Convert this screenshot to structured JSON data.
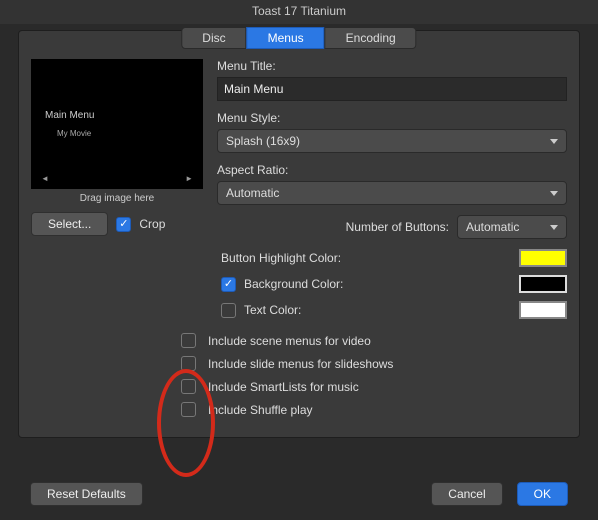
{
  "window": {
    "title": "Toast 17 Titanium"
  },
  "tabs": {
    "disc": "Disc",
    "menus": "Menus",
    "encoding": "Encoding",
    "active": "menus"
  },
  "preview": {
    "main_menu": "Main Menu",
    "my_movie": "My Movie",
    "drag_label": "Drag image here",
    "left_arrow": "◄",
    "right_arrow": "►"
  },
  "left": {
    "select_btn": "Select...",
    "crop_label": "Crop",
    "crop_checked": true
  },
  "fields": {
    "menu_title_label": "Menu Title:",
    "menu_title_value": "Main Menu",
    "menu_style_label": "Menu Style:",
    "menu_style_value": "Splash (16x9)",
    "aspect_label": "Aspect Ratio:",
    "aspect_value": "Automatic",
    "num_buttons_label": "Number of Buttons:",
    "num_buttons_value": "Automatic"
  },
  "colors": {
    "highlight_label": "Button Highlight Color:",
    "highlight_value": "#ffff00",
    "background_label": "Background Color:",
    "background_checked": true,
    "background_value": "#000000",
    "text_label": "Text Color:",
    "text_checked": false,
    "text_value": "#ffffff"
  },
  "includes": {
    "scene": {
      "label": "Include scene menus for video",
      "checked": false
    },
    "slide": {
      "label": "Include slide menus for slideshows",
      "checked": false
    },
    "smart": {
      "label": "Include SmartLists for music",
      "checked": false
    },
    "shuffle": {
      "label": "Include Shuffle play",
      "checked": false
    }
  },
  "buttons": {
    "reset": "Reset Defaults",
    "cancel": "Cancel",
    "ok": "OK"
  }
}
